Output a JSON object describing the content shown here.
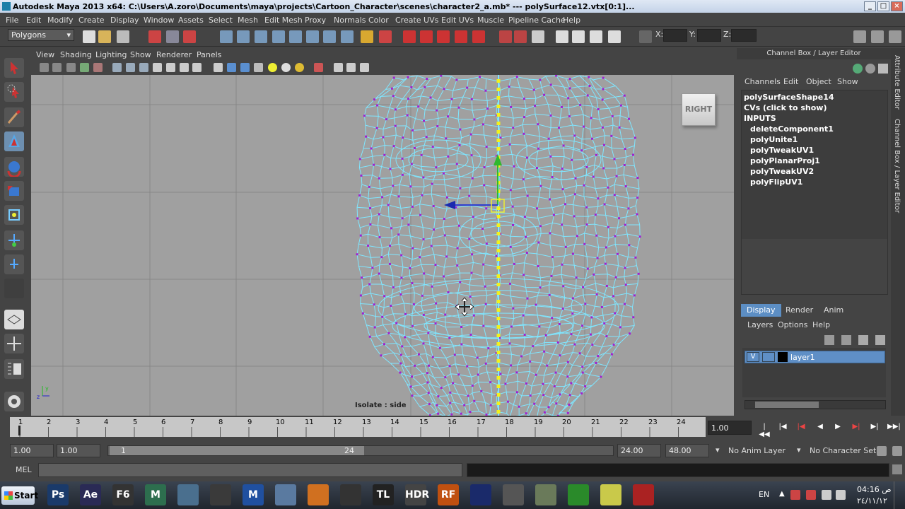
{
  "window": {
    "title": "Autodesk Maya 2013 x64: C:\\Users\\A.zoro\\Documents\\maya\\projects\\Cartoon_Character\\scenes\\character2_a.mb*   ---   polySurface12.vtx[0:1]..."
  },
  "menubar": [
    "File",
    "Edit",
    "Modify",
    "Create",
    "Display",
    "Window",
    "Assets",
    "Select",
    "Mesh",
    "Edit Mesh",
    "Proxy",
    "Normals",
    "Color",
    "Create UVs",
    "Edit UVs",
    "Muscle",
    "Pipeline Cache",
    "Help"
  ],
  "statusline": {
    "mode": "Polygons",
    "x_label": "X:",
    "y_label": "Y:",
    "z_label": "Z:"
  },
  "panel": {
    "menus": [
      "View",
      "Shading",
      "Lighting",
      "Show",
      "Renderer",
      "Panels"
    ]
  },
  "viewport": {
    "view_cube_label": "RIGHT",
    "isolate_label": "Isolate : side",
    "wire_color": "#7fe6ff",
    "vertex_color": "#a020d0",
    "bg_color": "#a0a0a0"
  },
  "channel_box": {
    "title": "Channel Box / Layer Editor",
    "menus": [
      "Channels",
      "Edit",
      "Object",
      "Show"
    ],
    "shape": "polySurfaceShape14",
    "cvs": "CVs (click to show)",
    "inputs_label": "INPUTS",
    "inputs": [
      "deleteComponent1",
      "polyUnite1",
      "polyTweakUV1",
      "polyPlanarProj1",
      "polyTweakUV2",
      "polyFlipUV1"
    ]
  },
  "layer_editor": {
    "tabs": [
      "Display",
      "Render",
      "Anim"
    ],
    "active_tab": "Display",
    "menus": [
      "Layers",
      "Options",
      "Help"
    ],
    "layer": {
      "visible": "V",
      "name": "layer1"
    }
  },
  "side_tabs": [
    "Attribute Editor",
    "Channel Box / Layer Editor"
  ],
  "timeline": {
    "ticks": [
      "1",
      "2",
      "3",
      "4",
      "5",
      "6",
      "7",
      "8",
      "9",
      "10",
      "11",
      "12",
      "13",
      "14",
      "15",
      "16",
      "17",
      "18",
      "19",
      "20",
      "21",
      "22",
      "23",
      "24"
    ],
    "current_frame": "1.00"
  },
  "range": {
    "start1": "1.00",
    "start2": "1.00",
    "slider_start": "1",
    "slider_end": "24",
    "end1": "24.00",
    "end2": "48.00",
    "anim_layer": "No Anim Layer",
    "char_set": "No Character Set"
  },
  "cmd": {
    "label": "MEL"
  },
  "taskbar": {
    "start": "Start",
    "apps": [
      {
        "label": "Ps",
        "color": "#1a3a6a"
      },
      {
        "label": "Ae",
        "color": "#2a2a55"
      },
      {
        "label": "F6",
        "color": "#333333"
      },
      {
        "label": "M",
        "color": "#2d6e4e"
      },
      {
        "label": "",
        "color": "#4a6f8e"
      },
      {
        "label": "",
        "color": "#3a3a3a"
      },
      {
        "label": "M",
        "color": "#2050a0"
      },
      {
        "label": "",
        "color": "#5a7aa0"
      },
      {
        "label": "",
        "color": "#d07020"
      },
      {
        "label": "",
        "color": "#333333"
      },
      {
        "label": "TL",
        "color": "#222222"
      },
      {
        "label": "HDR",
        "color": "#444444"
      },
      {
        "label": "RF",
        "color": "#c05010"
      },
      {
        "label": "",
        "color": "#1a2a6a"
      },
      {
        "label": "",
        "color": "#555555"
      },
      {
        "label": "",
        "color": "#6a7a5a"
      },
      {
        "label": "",
        "color": "#2a8a2a"
      },
      {
        "label": "",
        "color": "#c9c94a"
      },
      {
        "label": "",
        "color": "#aa2222"
      }
    ],
    "lang": "EN",
    "time": "04:16 ص",
    "date": "٢٤/١١/١٢"
  }
}
